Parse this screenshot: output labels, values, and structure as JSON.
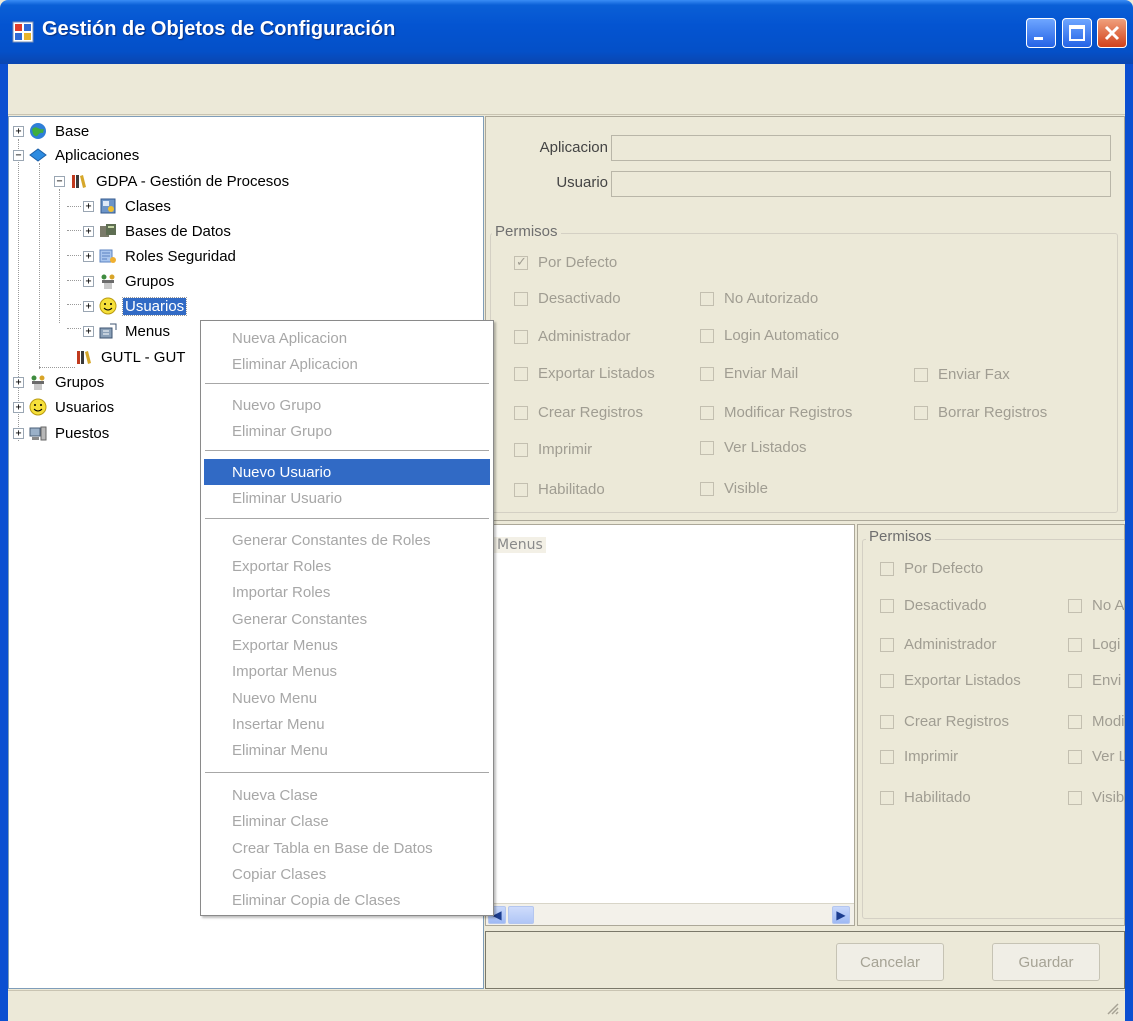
{
  "window": {
    "title": "Gestión de Objetos de Configuración",
    "controls": {
      "minimize": "minimize-icon",
      "maximize": "maximize-icon",
      "close": "close-icon"
    },
    "accent": "#0454d1"
  },
  "tree": {
    "nodes": [
      {
        "label": "Base",
        "icon": "globe-icon",
        "state": "collapsed"
      },
      {
        "label": "Aplicaciones",
        "icon": "book-icon",
        "state": "expanded"
      },
      {
        "label": "GDPA - Gestión de Procesos",
        "icon": "library-icon",
        "state": "expanded"
      },
      {
        "label": "Clases",
        "icon": "classes-icon",
        "state": "collapsed"
      },
      {
        "label": "Bases de Datos",
        "icon": "database-icon",
        "state": "collapsed"
      },
      {
        "label": "Roles Seguridad",
        "icon": "roles-icon",
        "state": "collapsed"
      },
      {
        "label": "Grupos",
        "icon": "groups-icon",
        "state": "collapsed"
      },
      {
        "label": "Usuarios",
        "icon": "smiley-icon",
        "state": "collapsed",
        "selected": true
      },
      {
        "label": "Menus",
        "icon": "menus-icon",
        "state": "collapsed"
      },
      {
        "label": "GUTL - GUT",
        "icon": "library-icon",
        "state": "leaf"
      },
      {
        "label": "Grupos",
        "icon": "groups-icon",
        "state": "collapsed"
      },
      {
        "label": "Usuarios",
        "icon": "smiley-icon",
        "state": "collapsed"
      },
      {
        "label": "Puestos",
        "icon": "workstation-icon",
        "state": "collapsed"
      }
    ]
  },
  "form": {
    "aplicacion_label": "Aplicacion",
    "usuario_label": "Usuario",
    "aplicacion_value": "",
    "usuario_value": "",
    "permisos_title": "Permisos",
    "permisos": [
      {
        "label": "Por Defecto",
        "checked": true
      },
      {
        "label": "Desactivado",
        "checked": false
      },
      {
        "label": "No Autorizado",
        "checked": false
      },
      {
        "label": "Administrador",
        "checked": false
      },
      {
        "label": "Login Automatico",
        "checked": false
      },
      {
        "label": "Exportar Listados",
        "checked": false
      },
      {
        "label": "Enviar Mail",
        "checked": false
      },
      {
        "label": "Enviar Fax",
        "checked": false
      },
      {
        "label": "Crear Registros",
        "checked": false
      },
      {
        "label": "Modificar Registros",
        "checked": false
      },
      {
        "label": "Borrar Registros",
        "checked": false
      },
      {
        "label": "Imprimir",
        "checked": false
      },
      {
        "label": "Ver Listados",
        "checked": false
      },
      {
        "label": "Habilitado",
        "checked": false
      },
      {
        "label": "Visible",
        "checked": false
      }
    ]
  },
  "menus_panel": {
    "root_label": "Menus",
    "scroll_left": "◀",
    "scroll_right": "▶"
  },
  "permisos2": {
    "title": "Permisos",
    "items": [
      {
        "label": "Por Defecto"
      },
      {
        "label": "Desactivado"
      },
      {
        "label": "No A"
      },
      {
        "label": "Administrador"
      },
      {
        "label": "Logi"
      },
      {
        "label": "Exportar Listados"
      },
      {
        "label": "Envi"
      },
      {
        "label": "Crear Registros"
      },
      {
        "label": "Modi"
      },
      {
        "label": "Imprimir"
      },
      {
        "label": "Ver L"
      },
      {
        "label": "Habilitado"
      },
      {
        "label": "Visib"
      }
    ]
  },
  "buttons": {
    "cancelar": "Cancelar",
    "guardar": "Guardar"
  },
  "context_menu": {
    "items": [
      {
        "label": "Nueva Aplicacion"
      },
      {
        "label": "Eliminar Aplicacion"
      },
      {
        "label": "Nuevo Grupo"
      },
      {
        "label": "Eliminar Grupo"
      },
      {
        "label": "Nuevo Usuario",
        "active": true
      },
      {
        "label": "Eliminar Usuario"
      },
      {
        "label": "Generar Constantes de Roles"
      },
      {
        "label": "Exportar Roles"
      },
      {
        "label": "Importar Roles"
      },
      {
        "label": "Generar Constantes"
      },
      {
        "label": "Exportar Menus"
      },
      {
        "label": "Importar Menus"
      },
      {
        "label": "Nuevo Menu"
      },
      {
        "label": "Insertar Menu"
      },
      {
        "label": "Eliminar Menu"
      },
      {
        "label": "Nueva Clase"
      },
      {
        "label": "Eliminar Clase"
      },
      {
        "label": "Crear Tabla en Base de Datos"
      },
      {
        "label": "Copiar Clases"
      },
      {
        "label": "Eliminar Copia de Clases"
      }
    ],
    "highlight_color": "#316ac5"
  }
}
